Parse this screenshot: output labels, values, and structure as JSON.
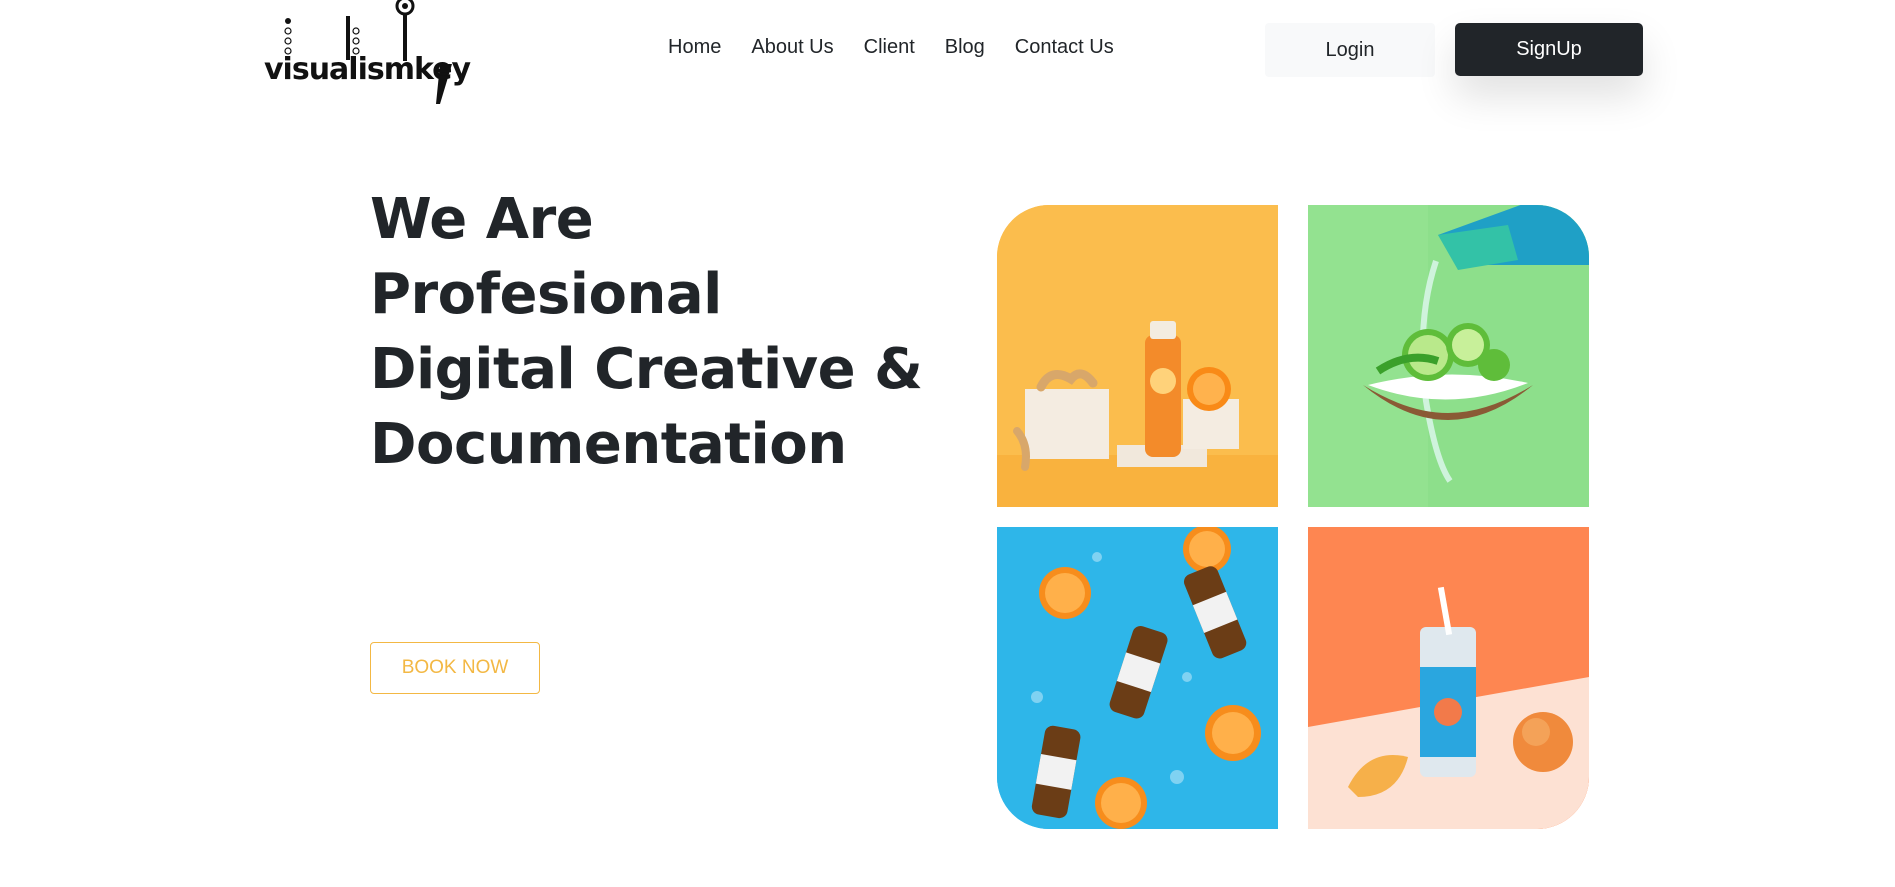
{
  "brand": {
    "name": "visualismkey"
  },
  "nav": {
    "items": [
      {
        "label": "Home"
      },
      {
        "label": "About Us"
      },
      {
        "label": "Client"
      },
      {
        "label": "Blog"
      },
      {
        "label": "Contact Us"
      }
    ]
  },
  "auth": {
    "login_label": "Login",
    "signup_label": "SignUp"
  },
  "hero": {
    "title_lines": [
      "We Are",
      "Profesional",
      "Digital Creative &",
      "Documentation"
    ],
    "cta_label": "BOOK NOW"
  },
  "colors": {
    "accent": "#f3b844",
    "dark": "#212529",
    "tile_yellow": "#fbbd4d",
    "tile_green": "#8ddf8b",
    "tile_blue": "#2eb6e9",
    "tile_orange": "#fe8651"
  },
  "gallery": {
    "images": [
      {
        "icon": "juice-bottle-photo"
      },
      {
        "icon": "coconut-lime-photo"
      },
      {
        "icon": "tea-bottles-photo"
      },
      {
        "icon": "peach-can-photo"
      }
    ]
  }
}
